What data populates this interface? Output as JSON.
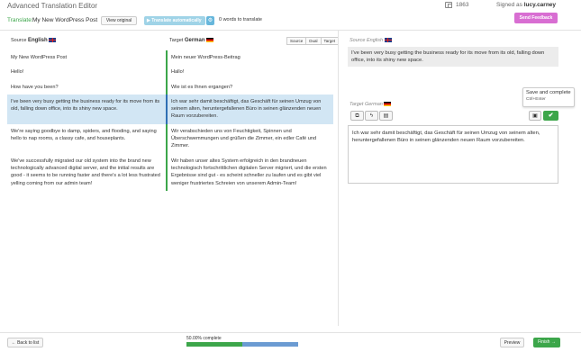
{
  "app": {
    "title": "Advanced Translation Editor",
    "counter": "1863",
    "signed_prefix": "Signed as",
    "user": "lucy.carney",
    "feedback_label": "Send Feedback"
  },
  "toolbar": {
    "translate_label": "Translate:",
    "post_title": "My New WordPress Post",
    "view_original_label": "View original",
    "auto_label": "Translate automatically",
    "words_label": "0 words to translate"
  },
  "left": {
    "source_prefix": "Source",
    "source_lang": "English",
    "target_prefix": "Target",
    "target_lang": "German",
    "view_modes": [
      "Source",
      "Dual",
      "Target"
    ],
    "segments": [
      {
        "source": "My New WordPress Post",
        "target": "Mein neuer WordPress-Beitrag"
      },
      {
        "source": "Hello!",
        "target": "Hallo!"
      },
      {
        "source": "How have you been?",
        "target": "Wie ist es Ihnen ergangen?"
      },
      {
        "source": "I've been very busy getting the business ready for its move from its old, falling down office, into its shiny new space.",
        "target": "Ich war sehr damit beschäftigt, das Geschäft für seinen Umzug von seinem alten, heruntergefallenen Büro in seinen glänzenden neuen Raum vorzubereiten."
      },
      {
        "source": "We're saying goodbye to damp, spiders, and flooding, and saying hello to nap rooms, a classy cafe, and houseplants.",
        "target": "Wir verabschieden uns von Feuchtigkeit, Spinnen und Überschwemmungen und grüßen die Zimmer, ein edler Café und Zimmer."
      },
      {
        "source": "We've successfully migrated our old system into the brand new technologically advanced digital server, and the initial results are good - it seems to be running faster and there's a lot less frustrated yelling coming from our admin team!",
        "target": "Wir haben unser altes System erfolgreich in den brandneuen technologisch fortschrittlichen digitalen Server migriert, und die ersten Ergebnisse sind gut - es scheint schneller zu laufen und es gibt viel weniger frustriertes Schreien von unserem Admin-Team!"
      }
    ]
  },
  "right": {
    "source_prefix": "Source",
    "source_lang": "English",
    "source_text": "I've been very busy getting the business ready for its move from its old, falling down office, into its shiny new space.",
    "target_prefix": "Target",
    "target_lang": "German",
    "target_text": "Ich war sehr damit beschäftigt, das Geschäft für seinen Umzug von seinem alten, heruntergefallenen Büro in seinen glänzenden neuen Raum vorzubereiten.",
    "tooltip_title": "Save and complete",
    "tooltip_shortcut": "Ctrl+Enter"
  },
  "footer": {
    "back_label": "← Back to list",
    "progress_label": "50.00% complete",
    "progress_fraction": 0.5,
    "preview_label": "Preview",
    "finish_label": "Finish →"
  },
  "colors": {
    "accent_green": "#3ca64a",
    "accent_blue": "#6b9bd2",
    "feedback_pink": "#d86ed2",
    "active_row": "#d2e6f4"
  }
}
